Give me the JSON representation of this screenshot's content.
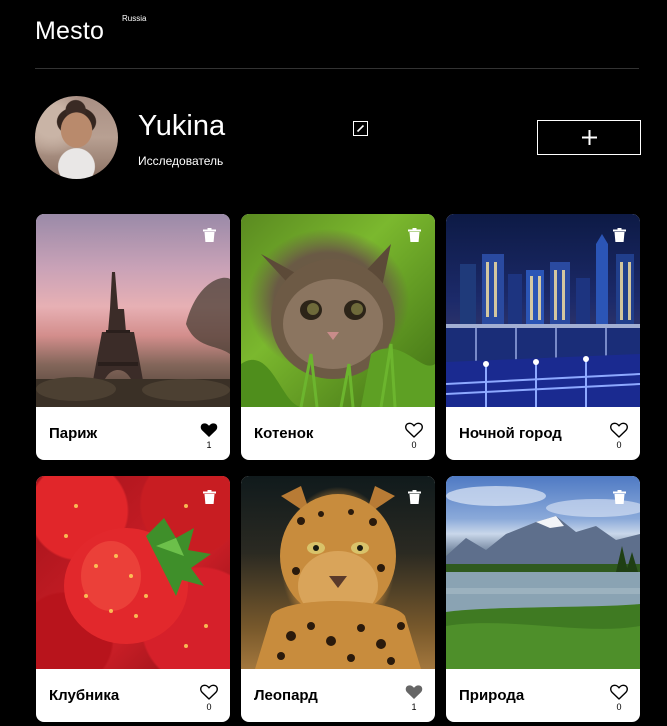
{
  "header": {
    "logo": "Mesto",
    "logo_region": "Russia"
  },
  "profile": {
    "name": "Yukina",
    "job": "Исследователь"
  },
  "colors": {
    "background": "#000000",
    "card": "#ffffff",
    "text_dark": "#000000",
    "divider": "#333333"
  },
  "icons": {
    "edit": "pencil-icon",
    "add": "plus-icon",
    "delete": "trash-icon",
    "like": "heart-icon"
  },
  "cards": [
    {
      "title": "Париж",
      "likes": "1",
      "liked": true
    },
    {
      "title": "Котенок",
      "likes": "0",
      "liked": false
    },
    {
      "title": "Ночной город",
      "likes": "0",
      "liked": false
    },
    {
      "title": "Клубника",
      "likes": "0",
      "liked": false
    },
    {
      "title": "Леопард",
      "likes": "1",
      "liked": true
    },
    {
      "title": "Природа",
      "likes": "0",
      "liked": false
    }
  ]
}
